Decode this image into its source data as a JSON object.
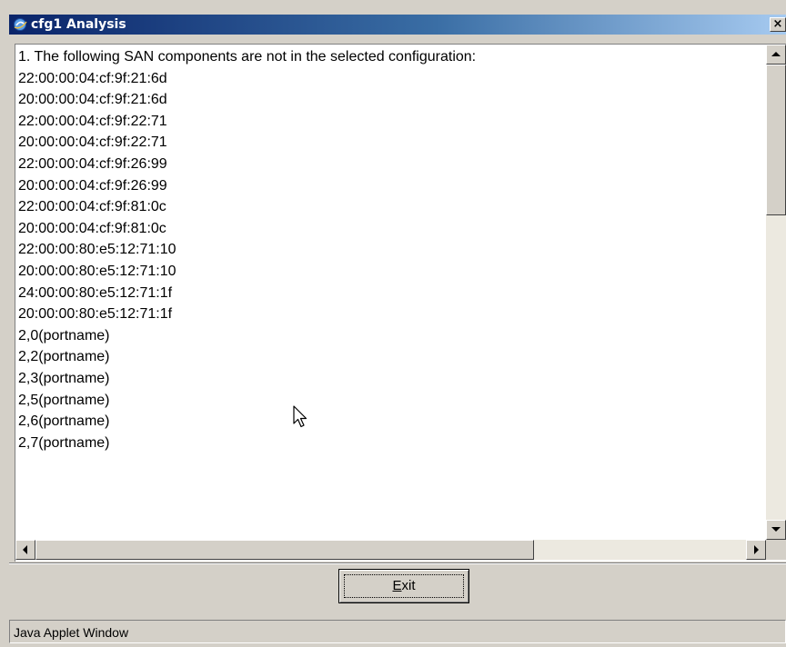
{
  "window": {
    "title": "cfg1 Analysis",
    "close_glyph": "×"
  },
  "text_area": {
    "lines": [
      "1. The following SAN components are not in the selected configuration:",
      "22:00:00:04:cf:9f:21:6d",
      "20:00:00:04:cf:9f:21:6d",
      "22:00:00:04:cf:9f:22:71",
      "20:00:00:04:cf:9f:22:71",
      "22:00:00:04:cf:9f:26:99",
      "20:00:00:04:cf:9f:26:99",
      "22:00:00:04:cf:9f:81:0c",
      "20:00:00:04:cf:9f:81:0c",
      "22:00:00:80:e5:12:71:10",
      "20:00:00:80:e5:12:71:10",
      "24:00:00:80:e5:12:71:1f",
      "20:00:00:80:e5:12:71:1f",
      "2,0(portname)",
      "2,2(portname)",
      "2,3(portname)",
      "2,5(portname)",
      "2,6(portname)",
      "2,7(portname)"
    ]
  },
  "buttons": {
    "exit_label": "Exit"
  },
  "status_bar": {
    "text": "Java Applet Window"
  },
  "icons": {
    "app": "ie-globe-icon",
    "close": "close-icon",
    "scroll_up": "arrow-up-icon",
    "scroll_down": "arrow-down-icon",
    "scroll_left": "arrow-left-icon",
    "scroll_right": "arrow-right-icon",
    "cursor": "mouse-pointer-icon"
  },
  "colors": {
    "titlebar_start": "#0a246a",
    "titlebar_end": "#a6caf0",
    "face": "#d4d0c8"
  }
}
